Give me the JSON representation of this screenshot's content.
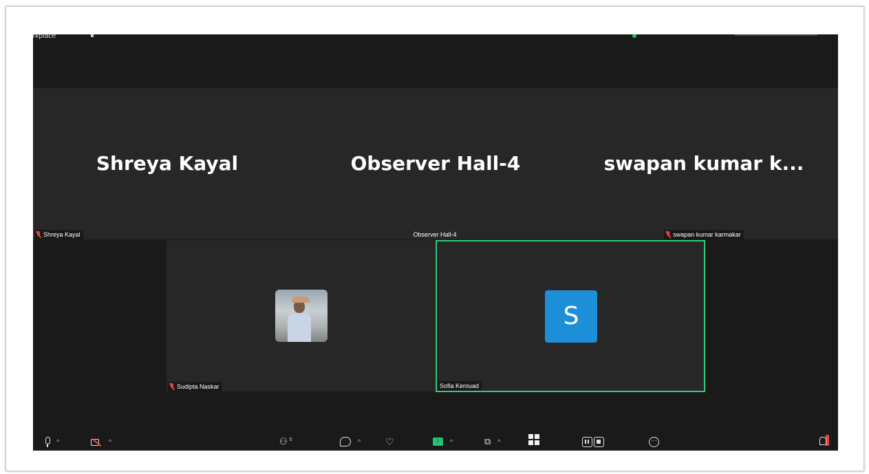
{
  "window": {
    "title": "orkplace"
  },
  "participants_top": [
    {
      "big_name": "Shreya Kayal",
      "label": "Shreya Kayal",
      "muted": true
    },
    {
      "big_name": "Observer Hall-4",
      "label": "Observer Hall-4",
      "muted": false
    },
    {
      "big_name": "swapan kumar k...",
      "label": "swapan kumar karmakar",
      "muted": true
    }
  ],
  "participants_bottom": [
    {
      "label": "Sudipta Naskar",
      "muted": true,
      "avatar": "photo"
    },
    {
      "label": "Sofia Kerouad",
      "muted": false,
      "avatar_letter": "S",
      "active_speaker": true
    }
  ],
  "toolbar": {
    "participants_count": "5",
    "share_glyph": "↑",
    "more_glyph": "···"
  },
  "colors": {
    "active_border": "#2fd07a",
    "avatar_letter_bg": "#1d8fd8",
    "muted_icon": "#e8443a",
    "share_button": "#23c472"
  },
  "icons": {
    "mic": "microphone-icon",
    "camera": "camera-off-icon",
    "participants": "participants-icon",
    "chat": "chat-icon",
    "react": "heart-icon",
    "share": "share-screen-icon",
    "apps": "apps-icon",
    "view": "grid-view-icon",
    "record": "record-icon",
    "more": "more-icon",
    "leave": "leave-icon"
  }
}
